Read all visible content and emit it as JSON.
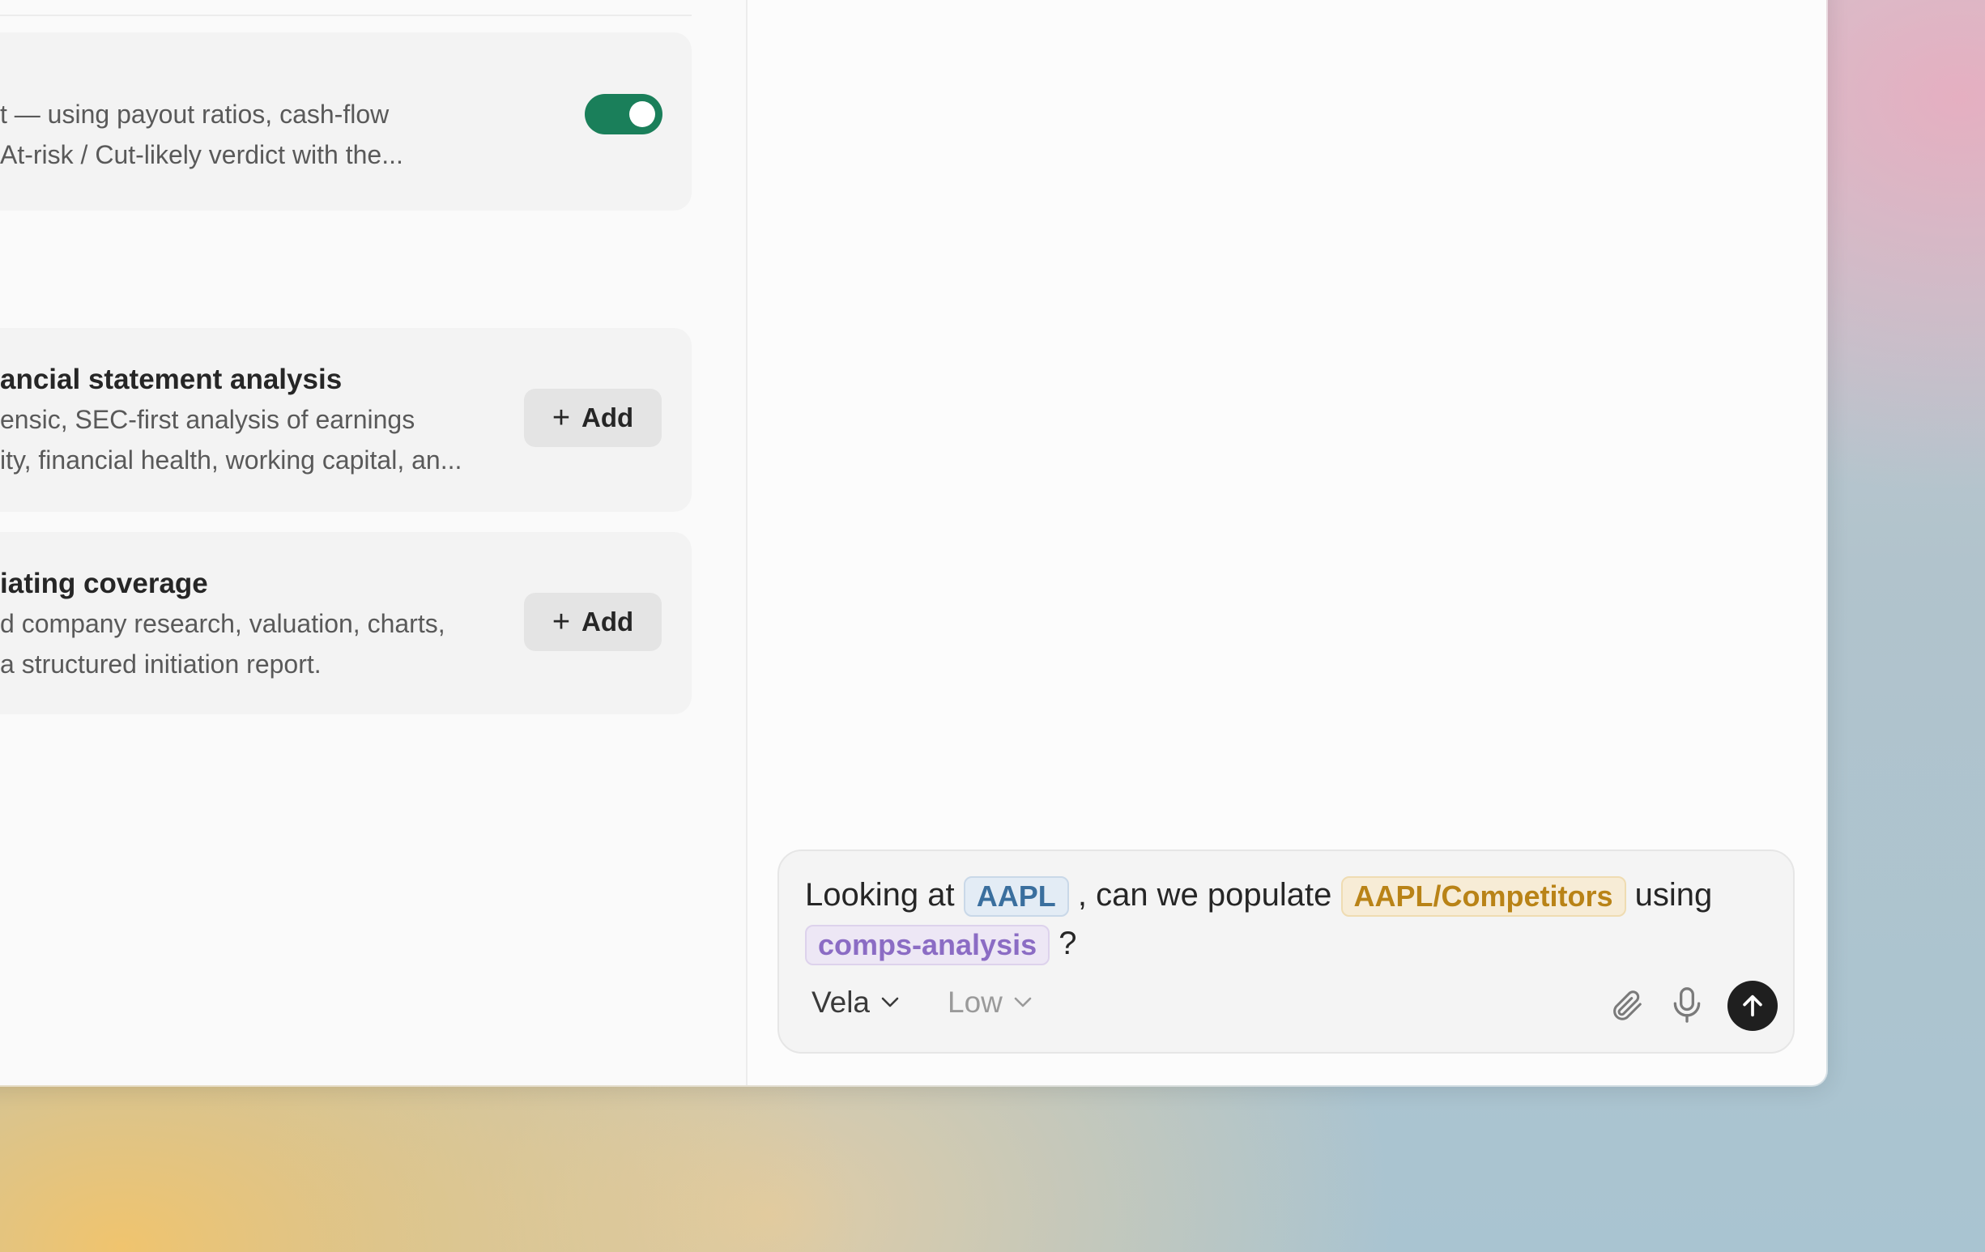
{
  "skills": {
    "enabled_item": {
      "description_line1": "t — using payout ratios, cash-flow",
      "description_line2": "At-risk / Cut-likely verdict with the...",
      "enabled": true
    },
    "available": [
      {
        "title": "ancial statement analysis",
        "description_line1": "ensic, SEC-first analysis of earnings",
        "description_line2": "ity, financial health, working capital, an...",
        "add_label": "Add"
      },
      {
        "title": "iating coverage",
        "description_line1": "d company research, valuation, charts,",
        "description_line2": "a structured initiation report.",
        "add_label": "Add"
      }
    ]
  },
  "composer": {
    "text_before_ticker": "Looking at",
    "ticker": "AAPL",
    "text_mid": ", can we populate",
    "file": "AAPL/Competitors",
    "text_using": "using",
    "skill": "comps-analysis",
    "text_end": "?",
    "model": "Vela",
    "effort": "Low",
    "attach_icon": "paperclip-icon",
    "mic_icon": "microphone-icon",
    "send_icon": "arrow-up-icon"
  },
  "colors": {
    "toggle_on": "#1a7f5a",
    "ticker_chip": "#3a6f9e",
    "file_chip": "#b98317",
    "skill_chip": "#8b6cc4",
    "send_button": "#1f1f1f"
  }
}
